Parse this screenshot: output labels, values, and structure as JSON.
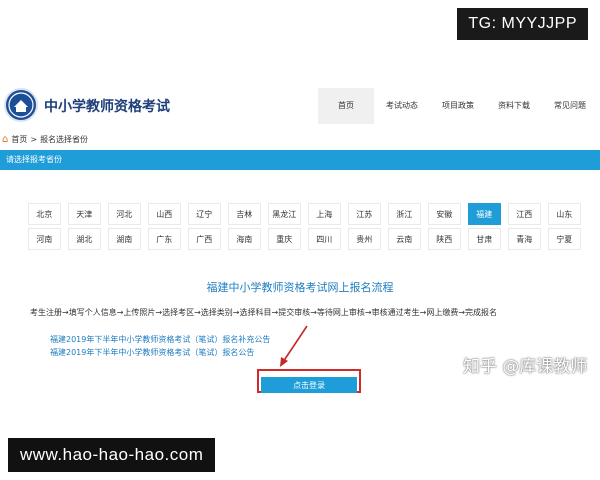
{
  "watermarks": {
    "top_right": "TG: MYYJJPP",
    "bottom_left": "www.hao-hao-hao.com",
    "zhihu": "知乎 @库课教师"
  },
  "header": {
    "title": "中小学教师资格考试",
    "nav": [
      "首页",
      "考试动态",
      "项目政策",
      "资料下载",
      "常见问题"
    ],
    "active_nav": "首页"
  },
  "breadcrumb": {
    "home": "首页",
    "separator": ">",
    "current": "报名选择省份"
  },
  "section_bar": "请选择报考省份",
  "provinces": {
    "row1": [
      "北京",
      "天津",
      "河北",
      "山西",
      "辽宁",
      "吉林",
      "黑龙江",
      "上海",
      "江苏",
      "浙江",
      "安徽",
      "福建",
      "江西",
      "山东"
    ],
    "row2": [
      "河南",
      "湖北",
      "湖南",
      "广东",
      "广西",
      "海南",
      "重庆",
      "四川",
      "贵州",
      "云南",
      "陕西",
      "甘肃",
      "青海",
      "宁夏"
    ],
    "selected": "福建"
  },
  "flow": {
    "title": "福建中小学教师资格考试网上报名流程",
    "steps": "考生注册→填写个人信息→上传照片→选择考区→选择类别→选择科目→提交审核→等待网上审核→审核通过考生→网上缴费→完成报名"
  },
  "notices": [
    "福建2019年下半年中小学教师资格考试（笔试）报名补充公告",
    "福建2019年下半年中小学教师资格考试（笔试）报名公告"
  ],
  "login_button": "点击登录",
  "colors": {
    "accent": "#1e9dd9",
    "highlight_frame": "#d12a2a",
    "logo": "#1f4e99"
  }
}
